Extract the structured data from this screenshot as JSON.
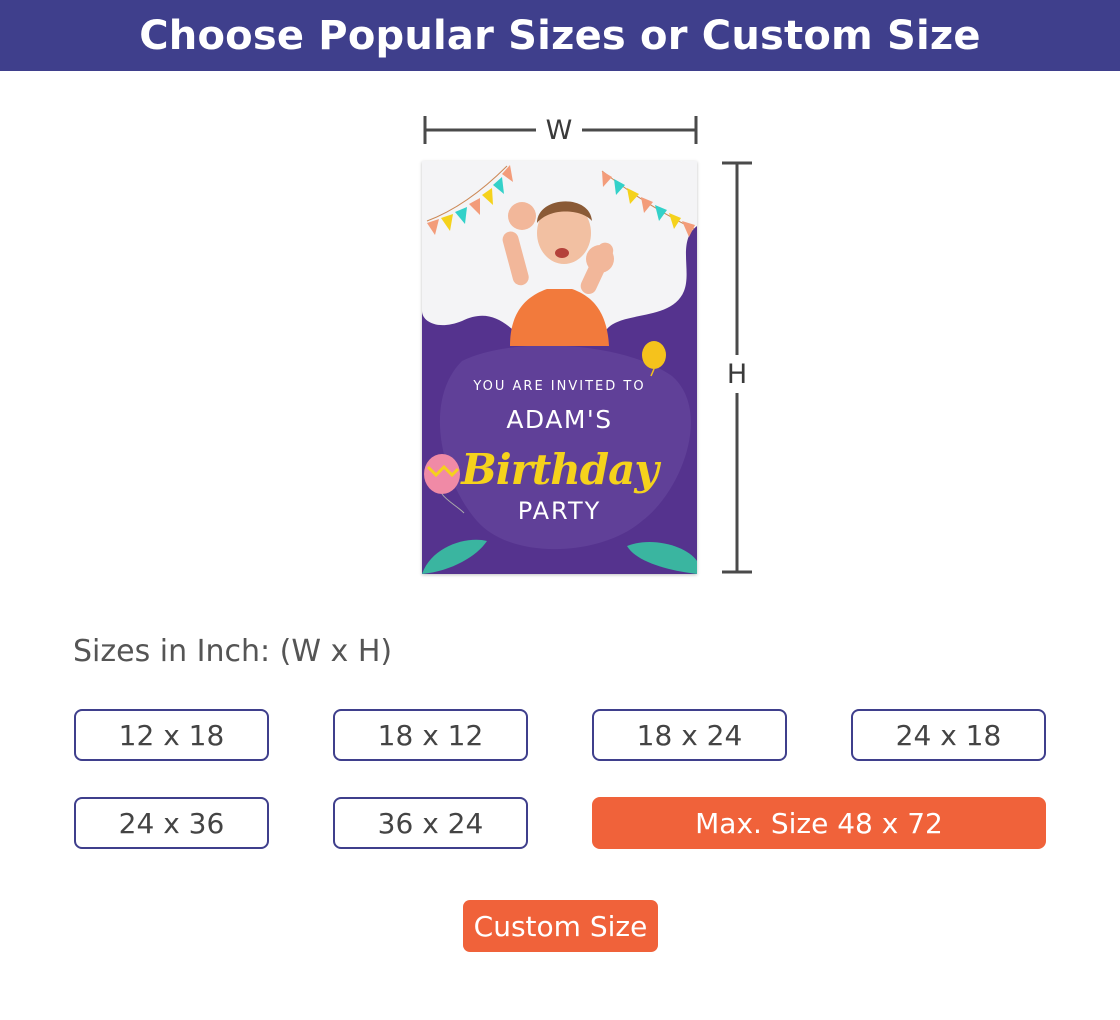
{
  "header": {
    "title": "Choose Popular Sizes or Custom Size"
  },
  "diagram": {
    "width_label": "W",
    "height_label": "H"
  },
  "poster": {
    "invited": "YOU ARE INVITED TO",
    "name": "ADAM'S",
    "birthday": "Birthday",
    "party": "PARTY"
  },
  "sizes": {
    "label": "Sizes in Inch: (W x H)",
    "options": [
      "12 x 18",
      "18 x 12",
      "18 x 24",
      "24 x 18",
      "24 x 36",
      "36 x 24"
    ],
    "max_label": "Max. Size 48 x 72"
  },
  "custom": {
    "label": "Custom Size"
  },
  "colors": {
    "header": "#3f3f8c",
    "accent": "#f0623a",
    "poster": "#55338e",
    "border": "#3f3f8c"
  }
}
